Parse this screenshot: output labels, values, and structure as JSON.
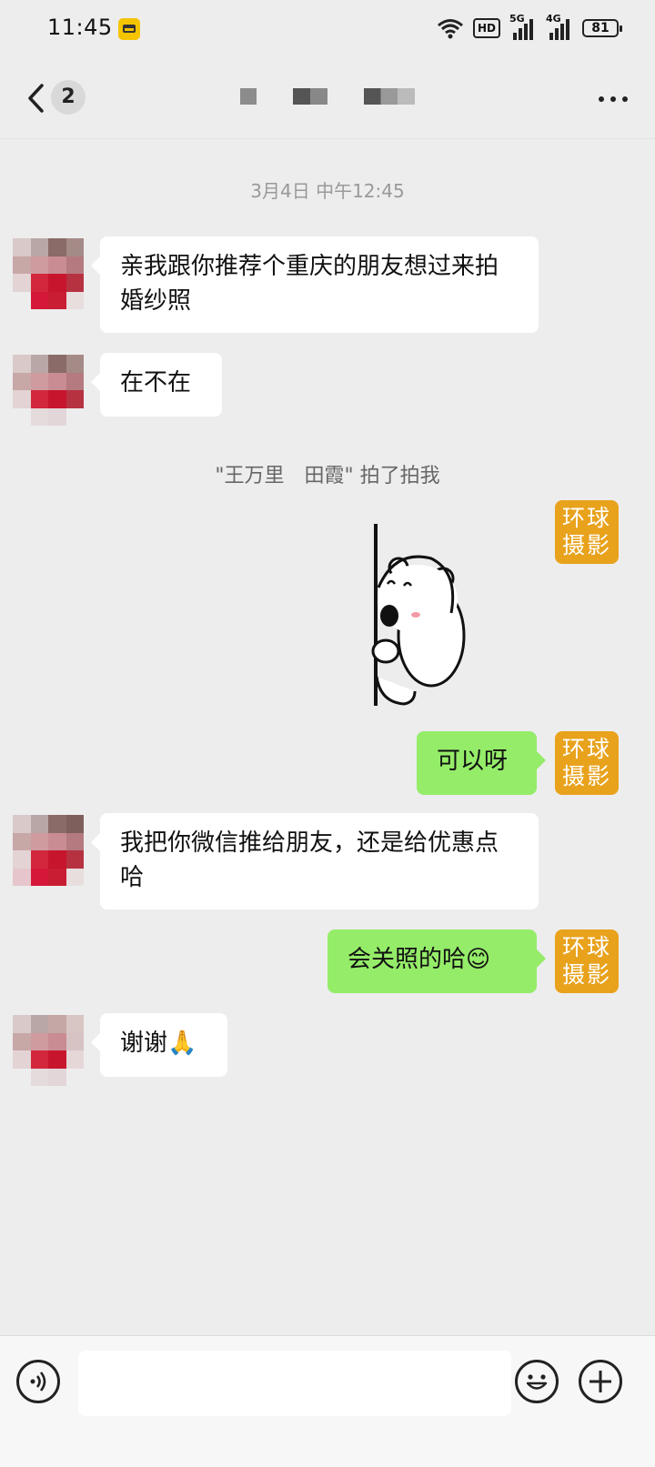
{
  "status_bar": {
    "time": "11:45",
    "hd_label": "HD",
    "sig1_label": "5G",
    "sig2_label": "4G",
    "battery": "81"
  },
  "nav": {
    "back_icon": "chevron-left-icon",
    "unread_count": "2",
    "more_icon": "more-dots-icon"
  },
  "chat": {
    "timestamp": "3月4日 中午12:45",
    "messages": [
      {
        "side": "left",
        "text": "亲我跟你推荐个重庆的朋友想过来拍婚纱照"
      },
      {
        "side": "left",
        "text": "在不在"
      },
      {
        "side": "right",
        "type": "sticker",
        "sticker": "bear-peeking-sticker"
      },
      {
        "side": "right",
        "text": "可以呀"
      },
      {
        "side": "left",
        "text": "我把你微信推给朋友，还是给优惠点哈"
      },
      {
        "side": "right",
        "text": "会关照的哈😊"
      },
      {
        "side": "left",
        "text": "谢谢🙏"
      }
    ],
    "pat_notice": "\"王万里　田霞\" 拍了拍我",
    "brand_avatar": {
      "line1": "环球",
      "line2": "摄影"
    }
  },
  "input_bar": {
    "voice_icon": "voice-icon",
    "emoji_icon": "emoji-icon",
    "plus_icon": "plus-icon"
  },
  "colors": {
    "background": "#ededed",
    "my_bubble": "#95ec69",
    "their_bubble": "#ffffff",
    "brand_avatar": "#e8a21c"
  }
}
